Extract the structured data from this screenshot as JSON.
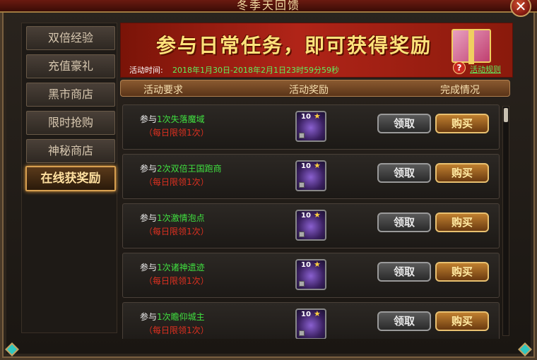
{
  "window": {
    "title": "冬季天回馈",
    "close_label": "✕"
  },
  "sidebar": {
    "items": [
      {
        "label": "双倍经验",
        "active": false
      },
      {
        "label": "充值豪礼",
        "active": false
      },
      {
        "label": "黑市商店",
        "active": false
      },
      {
        "label": "限时抢购",
        "active": false
      },
      {
        "label": "神秘商店",
        "active": false
      },
      {
        "label": "在线获奖励",
        "active": true
      }
    ]
  },
  "banner": {
    "title": "参与日常任务，即可获得奖励",
    "time_label": "活动时间:",
    "time_value": "2018年1月30日-2018年2月1日23时59分59秒",
    "help_icon": "?",
    "rules_link": "活动规则"
  },
  "columns": {
    "requirement": "活动要求",
    "reward": "活动奖励",
    "status": "完成情况"
  },
  "rows": [
    {
      "prefix": "参与",
      "task": "1次失落魔域",
      "limit": "（每日限领1次）",
      "reward_count": "10",
      "claim": "领取",
      "buy": "购买"
    },
    {
      "prefix": "参与",
      "task": "2次双倍王国跑商",
      "limit": "（每日限领1次）",
      "reward_count": "10",
      "claim": "领取",
      "buy": "购买"
    },
    {
      "prefix": "参与",
      "task": "1次激情泡点",
      "limit": "（每日限领1次）",
      "reward_count": "10",
      "claim": "领取",
      "buy": "购买"
    },
    {
      "prefix": "参与",
      "task": "1次诸神遗迹",
      "limit": "（每日限领1次）",
      "reward_count": "10",
      "claim": "领取",
      "buy": "购买"
    },
    {
      "prefix": "参与",
      "task": "1次瞻仰城主",
      "limit": "（每日限领1次）",
      "reward_count": "10",
      "claim": "领取",
      "buy": "购买"
    }
  ],
  "colors": {
    "highlight_green": "#40e040",
    "limit_red": "#e03020",
    "banner_title": "#ffe27a"
  }
}
